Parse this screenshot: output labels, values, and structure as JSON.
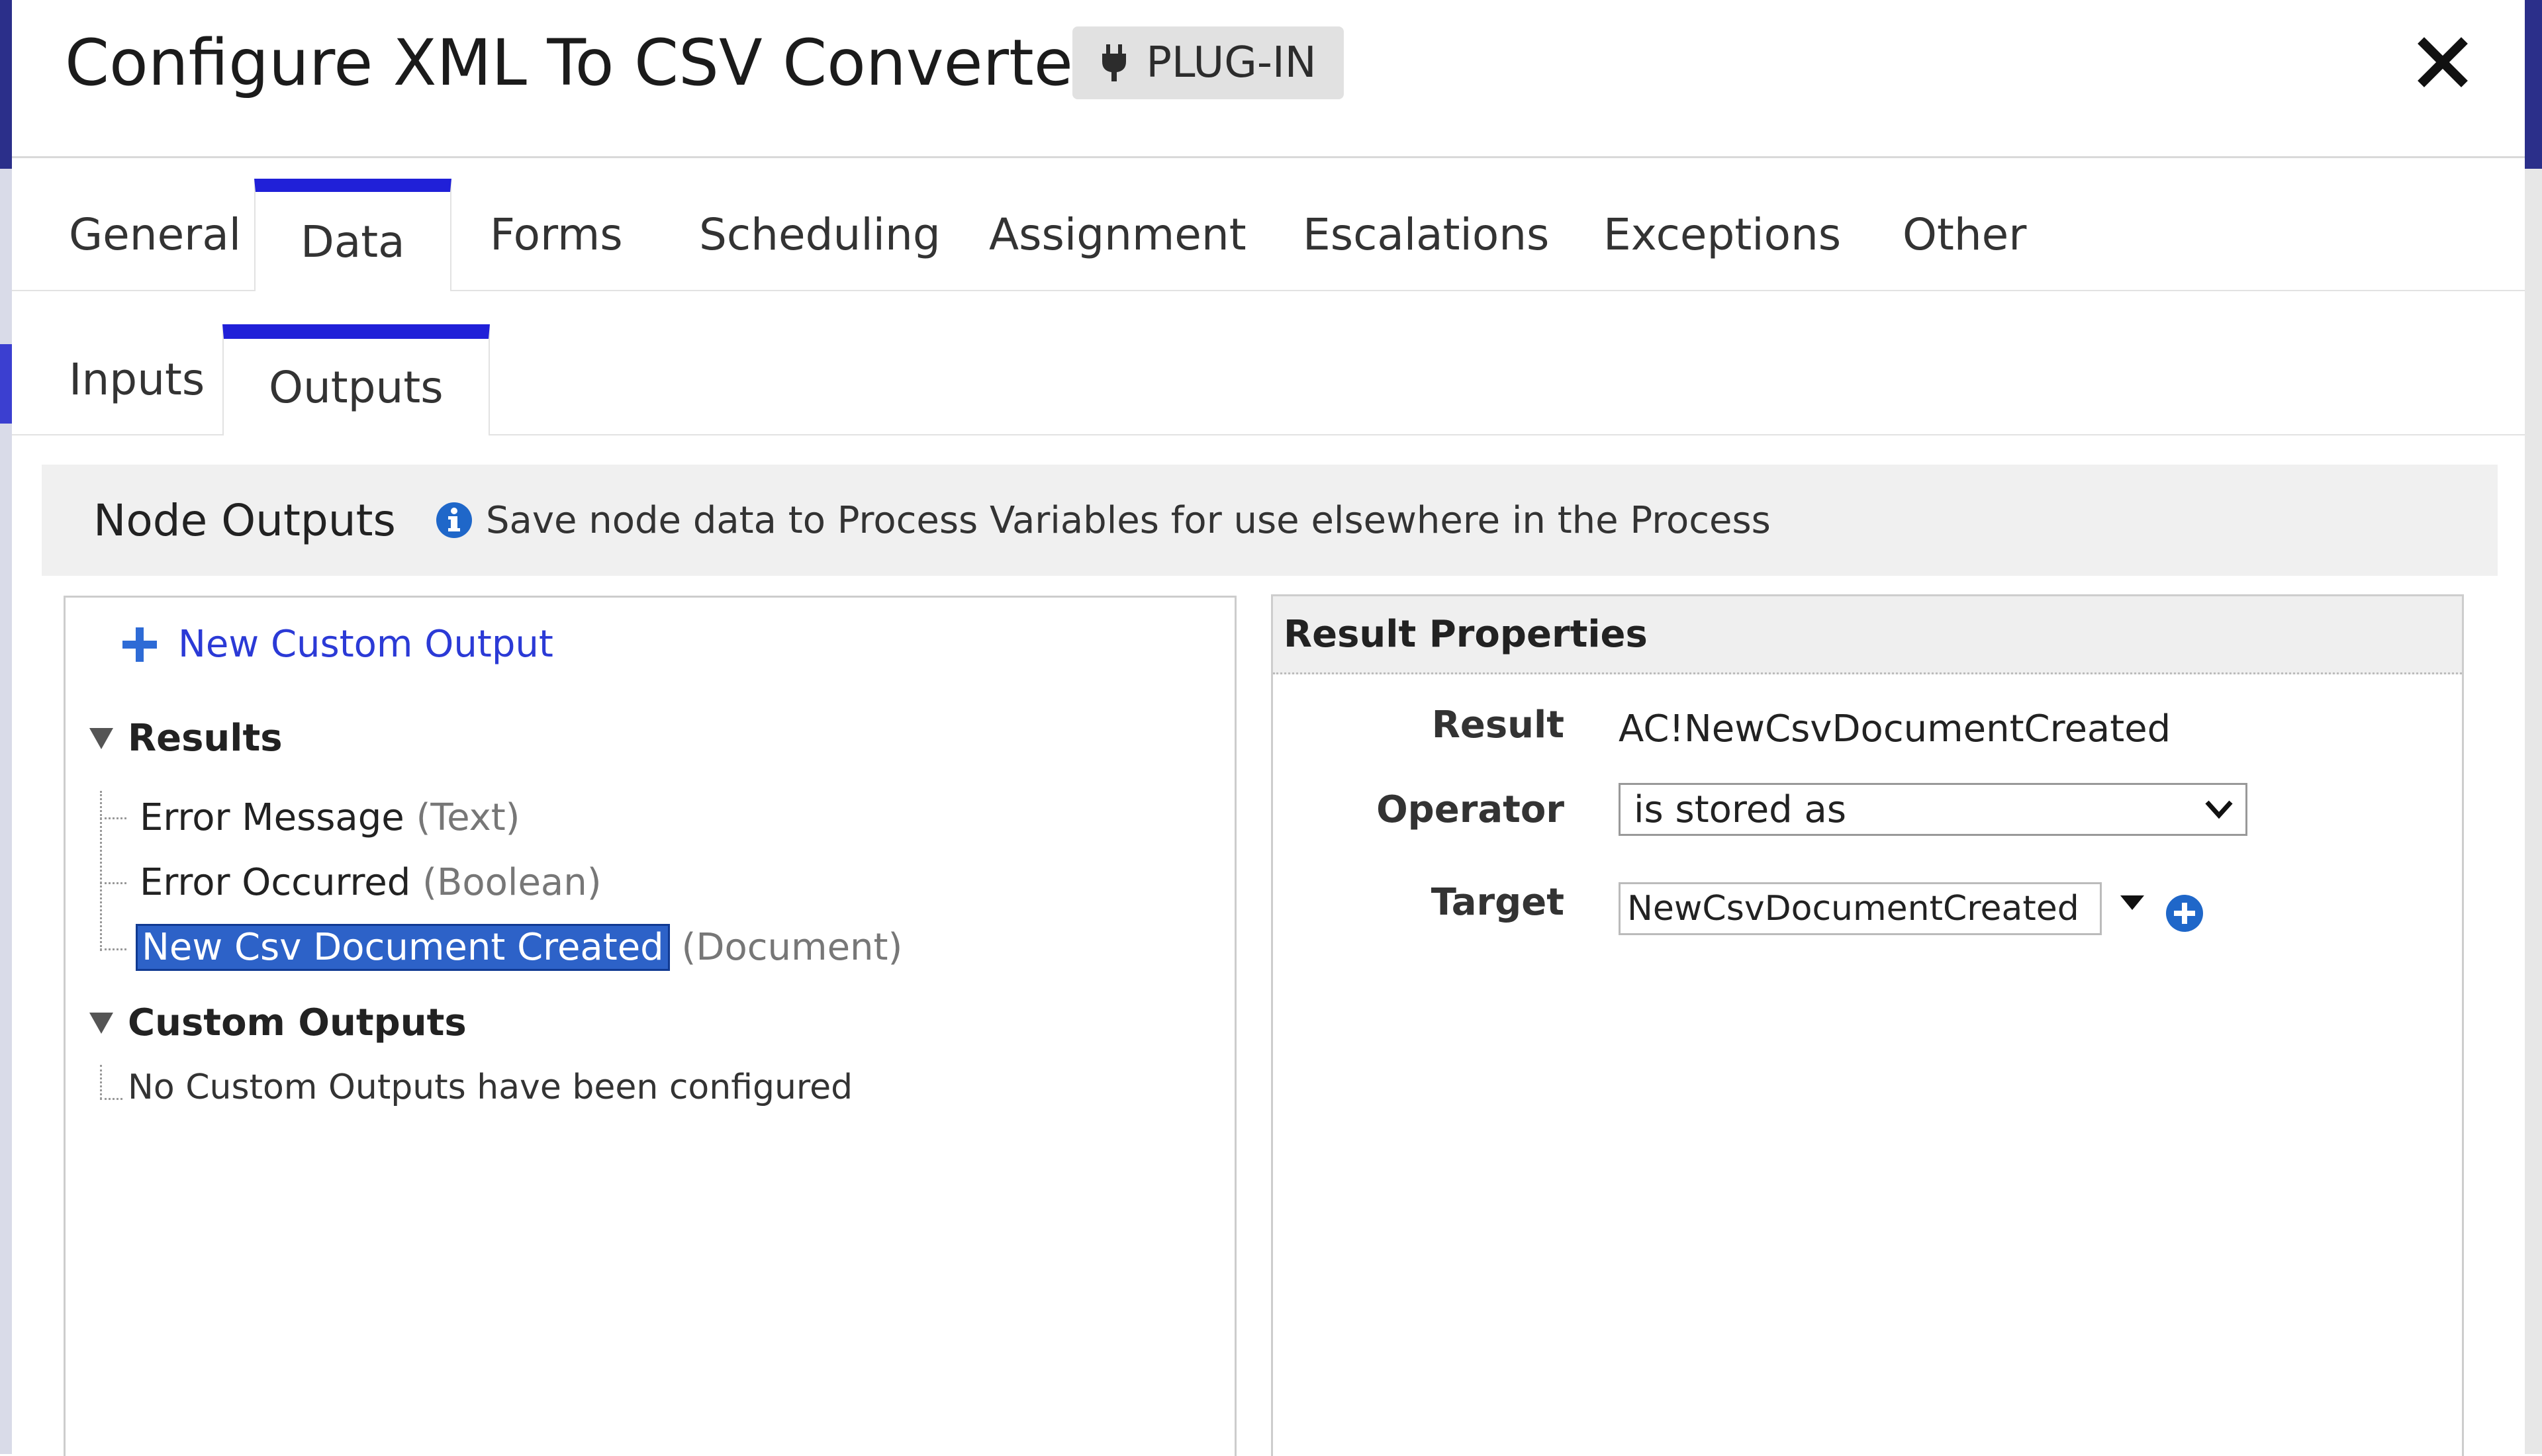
{
  "header": {
    "title": "Configure XML To CSV Converter",
    "badge_label": "PLUG-IN",
    "badge_icon": "plug-icon",
    "close_icon": "close-icon"
  },
  "main_tabs": [
    {
      "label": "General",
      "active": false
    },
    {
      "label": "Data",
      "active": true
    },
    {
      "label": "Forms",
      "active": false
    },
    {
      "label": "Scheduling",
      "active": false
    },
    {
      "label": "Assignment",
      "active": false
    },
    {
      "label": "Escalations",
      "active": false
    },
    {
      "label": "Exceptions",
      "active": false
    },
    {
      "label": "Other",
      "active": false
    }
  ],
  "sub_tabs": [
    {
      "label": "Inputs",
      "active": false
    },
    {
      "label": "Outputs",
      "active": true
    }
  ],
  "node_outputs": {
    "title": "Node Outputs",
    "info_text": "Save node data to Process Variables for use elsewhere in the Process"
  },
  "left_panel": {
    "new_custom_output_label": "New Custom Output",
    "results_heading": "Results",
    "results": [
      {
        "name": "Error Message",
        "type": "(Text)",
        "selected": false
      },
      {
        "name": "Error Occurred",
        "type": "(Boolean)",
        "selected": false
      },
      {
        "name": "New Csv Document Created",
        "type": "(Document)",
        "selected": true
      }
    ],
    "custom_outputs_heading": "Custom Outputs",
    "custom_outputs_empty": "No Custom Outputs have been configured"
  },
  "result_properties": {
    "title": "Result Properties",
    "result_label": "Result",
    "result_value": "AC!NewCsvDocumentCreated",
    "operator_label": "Operator",
    "operator_value": "is stored as",
    "target_label": "Target",
    "target_value": "NewCsvDocumentCreated"
  },
  "colors": {
    "accent": "#2020d8",
    "selection": "#2d62c8",
    "link": "#2b3ad6",
    "info_icon": "#1f67c9"
  }
}
